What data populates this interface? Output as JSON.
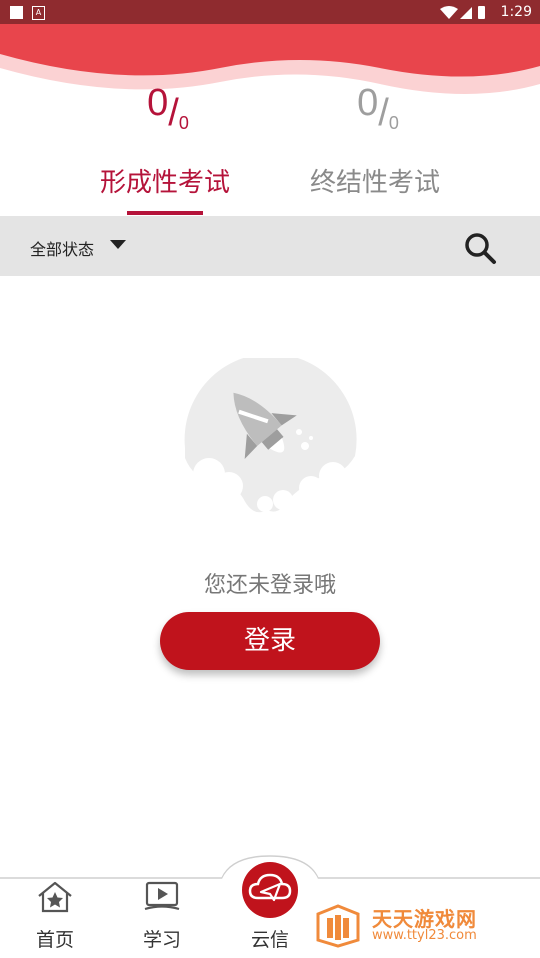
{
  "status_bar": {
    "time": "1:29"
  },
  "stats": {
    "formative": {
      "done": "0",
      "slash": "/",
      "total": "0"
    },
    "summative": {
      "done": "0",
      "slash": "/",
      "total": "0"
    }
  },
  "tabs": [
    {
      "label": "形成性考试",
      "active": true
    },
    {
      "label": "终结性考试",
      "active": false
    }
  ],
  "filter": {
    "label": "全部状态",
    "icon": "caret-down-icon",
    "search_icon": "search-icon"
  },
  "empty_state": {
    "illustration": "rocket-illustration",
    "message": "您还未登录哦",
    "login_button": "登录"
  },
  "bottom_nav": {
    "items": [
      {
        "label": "首页",
        "icon": "home-star-icon"
      },
      {
        "label": "学习",
        "icon": "video-book-icon"
      },
      {
        "label": "云信",
        "icon": "cloud-send-icon"
      }
    ]
  },
  "watermark": {
    "title": "天天游戏网",
    "url": "www.ttyl23.com"
  },
  "colors": {
    "accent": "#b5133a",
    "button": "#c0131c",
    "status_bar": "#8f2b2f",
    "header_wave": "#e8444b"
  }
}
